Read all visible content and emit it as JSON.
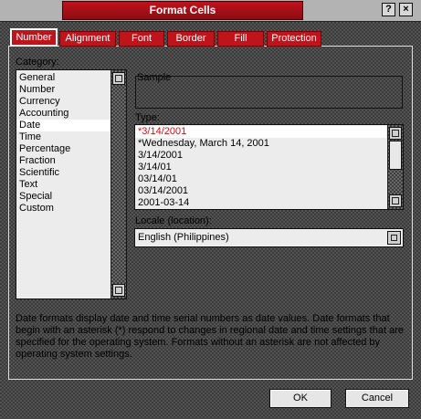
{
  "window": {
    "title": "Format Cells"
  },
  "title_buttons": {
    "help": "?",
    "close": "×"
  },
  "tabs": [
    {
      "label": "Number",
      "active": true
    },
    {
      "label": "Alignment",
      "active": false
    },
    {
      "label": "Font",
      "active": false
    },
    {
      "label": "Border",
      "active": false
    },
    {
      "label": "Fill",
      "active": false
    },
    {
      "label": "Protection",
      "active": false
    }
  ],
  "category": {
    "label": "Category:",
    "items": [
      "General",
      "Number",
      "Currency",
      "Accounting",
      "Date",
      "Time",
      "Percentage",
      "Fraction",
      "Scientific",
      "Text",
      "Special",
      "Custom"
    ],
    "selected": "Date"
  },
  "sample": {
    "label": "Sample",
    "value": ""
  },
  "type": {
    "label": "Type:",
    "items": [
      "*3/14/2001",
      "*Wednesday, March 14, 2001",
      "3/14/2001",
      "3/14/01",
      "03/14/01",
      "03/14/2001",
      "2001-03-14"
    ],
    "selected": "*3/14/2001"
  },
  "locale": {
    "label": "Locale (location):",
    "value": "English (Philippines)"
  },
  "description": "Date formats display date and time serial numbers as date values.  Date formats that begin with an asterisk (*) respond to changes in regional date and time settings that are specified for the operating system. Formats without an asterisk are not affected by operating system settings.",
  "buttons": {
    "ok": "OK",
    "cancel": "Cancel"
  },
  "colors": {
    "accent": "#c0141c",
    "title_bar": "#b3b3b3"
  }
}
